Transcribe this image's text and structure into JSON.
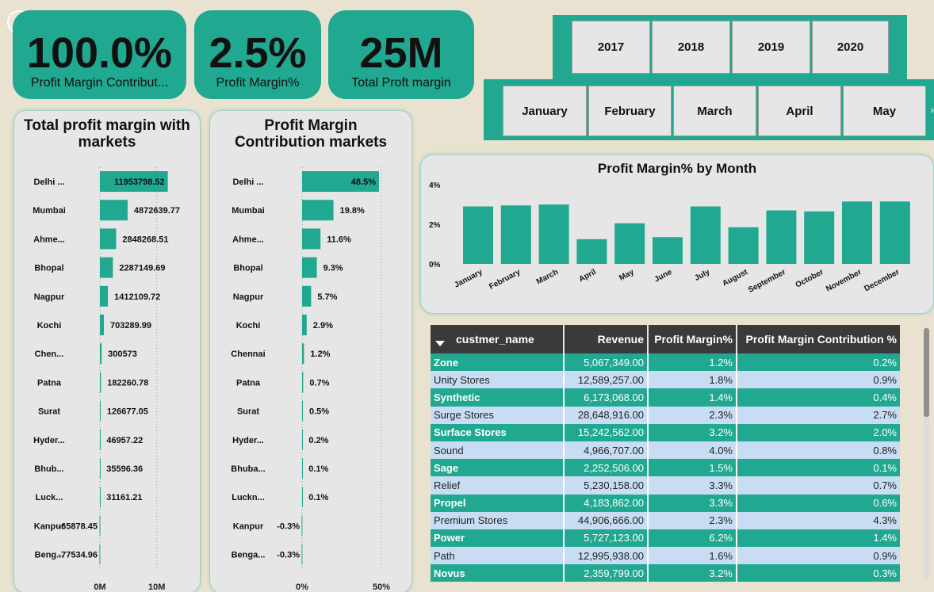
{
  "kpis": [
    {
      "value": "100.0%",
      "label": "Profit Margin Contribut..."
    },
    {
      "value": "2.5%",
      "label": "Profit Margin%"
    },
    {
      "value": "25M",
      "label": "Total Proft margin"
    }
  ],
  "year_slicer": {
    "items": [
      "2017",
      "2018",
      "2019",
      "2020"
    ]
  },
  "month_slicer": {
    "items": [
      "January",
      "February",
      "March",
      "April",
      "May"
    ],
    "more_indicator": "›"
  },
  "chart_data": [
    {
      "type": "bar",
      "orientation": "horizontal",
      "title": "Total profit margin with markets",
      "categories": [
        "Delhi ...",
        "Mumbai",
        "Ahme...",
        "Bhopal",
        "Nagpur",
        "Kochi",
        "Chen...",
        "Patna",
        "Surat",
        "Hyder...",
        "Bhub...",
        "Luck...",
        "Kanpur",
        "Beng..."
      ],
      "values": [
        11953798.52,
        4872639.77,
        2848268.51,
        2287149.69,
        1412109.72,
        703289.99,
        300573,
        182260.78,
        126677.05,
        46957.22,
        35596.36,
        31161.21,
        -65878.45,
        -77534.96
      ],
      "data_labels": [
        "11953798.52",
        "4872639.77",
        "2848268.51",
        "2287149.69",
        "1412109.72",
        "703289.99",
        "300573",
        "182260.78",
        "126677.05",
        "46957.22",
        "35596.36",
        "31161.21",
        "-65878.45",
        "-77534.96"
      ],
      "x_ticks": [
        "0M",
        "10M"
      ],
      "xlim": [
        -1700000,
        17000000
      ],
      "color": "#21a890"
    },
    {
      "type": "bar",
      "orientation": "horizontal",
      "title": "Profit Margin Contribution markets",
      "categories": [
        "Delhi ...",
        "Mumbai",
        "Ahme...",
        "Bhopal",
        "Nagpur",
        "Kochi",
        "Chennai",
        "Patna",
        "Surat",
        "Hyder...",
        "Bhuba...",
        "Luckn...",
        "Kanpur",
        "Benga..."
      ],
      "values": [
        48.5,
        19.8,
        11.6,
        9.3,
        5.7,
        2.9,
        1.2,
        0.7,
        0.5,
        0.2,
        0.1,
        0.1,
        -0.3,
        -0.3
      ],
      "data_labels": [
        "48.5%",
        "19.8%",
        "11.6%",
        "9.3%",
        "5.7%",
        "2.9%",
        "1.2%",
        "0.7%",
        "0.5%",
        "0.2%",
        "0.1%",
        "0.1%",
        "-0.3%",
        "-0.3%"
      ],
      "x_ticks": [
        "0%",
        "50%"
      ],
      "xlim": [
        0,
        50
      ],
      "color": "#21a890"
    },
    {
      "type": "bar",
      "title": "Profit Margin% by Month",
      "categories": [
        "January",
        "February",
        "March",
        "April",
        "May",
        "June",
        "July",
        "August",
        "September",
        "October",
        "November",
        "December"
      ],
      "values": [
        2.9,
        2.95,
        3.0,
        1.25,
        2.05,
        1.35,
        2.9,
        1.85,
        2.7,
        2.65,
        3.15,
        3.15
      ],
      "y_ticks": [
        "4%",
        "2%",
        "0%"
      ],
      "ylim": [
        0,
        4
      ],
      "color": "#21a890"
    }
  ],
  "table": {
    "headers": [
      "custmer_name",
      "Revenue",
      "Profit Margin%",
      "Profit Margin Contribution %"
    ],
    "rows": [
      [
        "Zone",
        "5,067,349.00",
        "1.2%",
        "0.2%"
      ],
      [
        "Unity Stores",
        "12,589,257.00",
        "1.8%",
        "0.9%"
      ],
      [
        "Synthetic",
        "6,173,068.00",
        "1.4%",
        "0.4%"
      ],
      [
        "Surge Stores",
        "28,648,916.00",
        "2.3%",
        "2.7%"
      ],
      [
        "Surface Stores",
        "15,242,562.00",
        "3.2%",
        "2.0%"
      ],
      [
        "Sound",
        "4,966,707.00",
        "4.0%",
        "0.8%"
      ],
      [
        "Sage",
        "2,252,506.00",
        "1.5%",
        "0.1%"
      ],
      [
        "Relief",
        "5,230,158.00",
        "3.3%",
        "0.7%"
      ],
      [
        "Propel",
        "4,183,862.00",
        "3.3%",
        "0.6%"
      ],
      [
        "Premium Stores",
        "44,906,666.00",
        "2.3%",
        "4.3%"
      ],
      [
        "Power",
        "5,727,123.00",
        "6.2%",
        "1.4%"
      ],
      [
        "Path",
        "12,995,938.00",
        "1.6%",
        "0.9%"
      ],
      [
        "Novus",
        "2,359,799.00",
        "3.2%",
        "0.3%"
      ]
    ]
  },
  "colors": {
    "accent": "#21a890",
    "background": "#e9e2d0",
    "header": "#3a3a3a",
    "row_alt": "#c8ddf3"
  }
}
